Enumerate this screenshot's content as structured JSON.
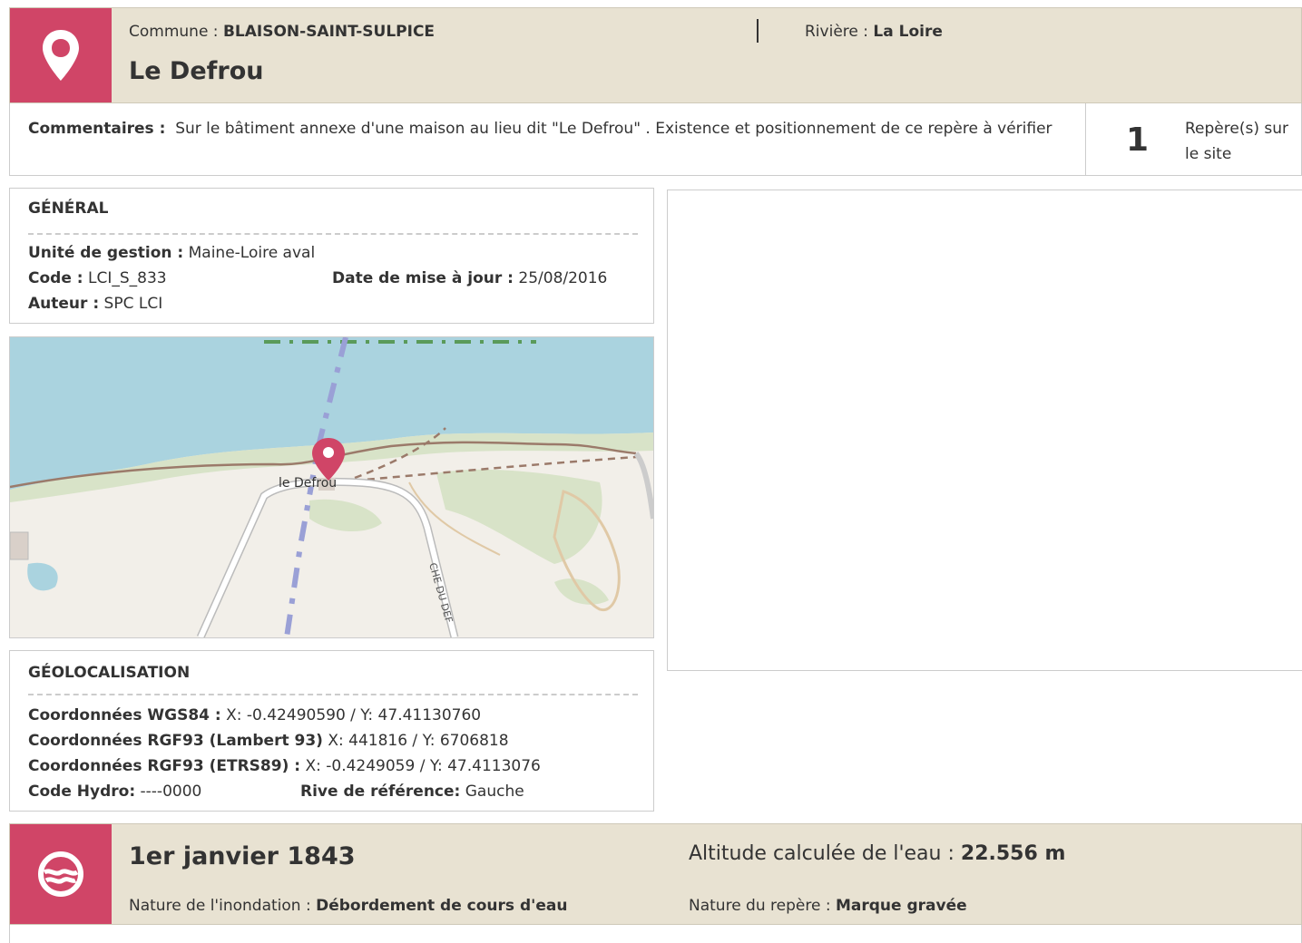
{
  "site": {
    "commune_label": "Commune :",
    "commune": "BLAISON-SAINT-SULPICE",
    "riviere_label": "Rivière :",
    "riviere": "La Loire",
    "title": "Le Defrou",
    "icon": "location-pin-icon"
  },
  "comment": {
    "label": "Commentaires :",
    "text": "Sur le bâtiment annexe d'une maison au lieu dit \"Le Defrou\" . Existence et positionnement de ce repère à vérifier",
    "repere_count": "1",
    "repere_label": "Repère(s) sur le site"
  },
  "general": {
    "title": "GÉNÉRAL",
    "unite_label": "Unité de gestion :",
    "unite": "Maine-Loire aval",
    "code_label": "Code :",
    "code": "LCI_S_833",
    "date_label": "Date de mise à jour :",
    "date": "25/08/2016",
    "auteur_label": "Auteur :",
    "auteur": "SPC LCI"
  },
  "map": {
    "place_label": "le Defrou",
    "road_label": "CHE DU DEF",
    "colors": {
      "water": "#aad3df",
      "land": "#f2efe9",
      "green": "#d8e3c8",
      "pin": "#d04567"
    }
  },
  "geo": {
    "title": "GÉOLOCALISATION",
    "wgs_label": "Coordonnées WGS84 :",
    "wgs": "X: -0.42490590 / Y: 47.41130760",
    "lambert_label": "Coordonnées RGF93 (Lambert 93)",
    "lambert": "X: 441816 / Y: 6706818",
    "etrs_label": "Coordonnées RGF93 (ETRS89) :",
    "etrs": "X: -0.4249059 / Y: 47.4113076",
    "hydro_label": "Code Hydro:",
    "hydro": "----0000",
    "rive_label": "Rive de référence:",
    "rive": "Gauche"
  },
  "event": {
    "date": "1er janvier 1843",
    "altitude_label": "Altitude calculée de l'eau :",
    "altitude": "22.556 m",
    "nature_inondation_label": "Nature de l'inondation :",
    "nature_inondation": "Débordement de cours d'eau",
    "nature_repere_label": "Nature du repère :",
    "nature_repere": "Marque gravée",
    "icon": "flood-wave-icon"
  },
  "colors": {
    "accent": "#d04567",
    "header_bg": "#e8e2d2",
    "border": "#cccccc"
  }
}
